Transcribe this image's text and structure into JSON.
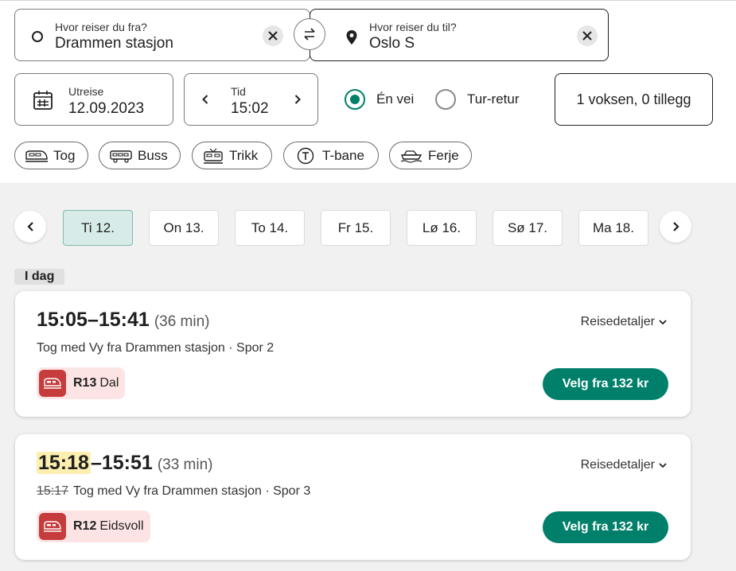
{
  "search": {
    "from": {
      "label": "Hvor reiser du fra?",
      "value": "Drammen stasjon"
    },
    "to": {
      "label": "Hvor reiser du til?",
      "value": "Oslo S"
    },
    "date": {
      "label": "Utreise",
      "value": "12.09.2023"
    },
    "time": {
      "label": "Tid",
      "value": "15:02"
    },
    "trip_type": {
      "one_way": "Én vei",
      "round_trip": "Tur-retur",
      "selected": "one_way"
    },
    "passengers": "1 voksen, 0 tillegg"
  },
  "transport_modes": [
    "Tog",
    "Buss",
    "Trikk",
    "T-bane",
    "Ferje"
  ],
  "dates": [
    "Ti 12.",
    "On 13.",
    "To 14.",
    "Fr 15.",
    "Lø 16.",
    "Sø 17.",
    "Ma 18."
  ],
  "day_label": "I dag",
  "trips": [
    {
      "dep": "15:05",
      "arr": "15:41",
      "sep": "–",
      "duration": "(36 min)",
      "details": "Reisedetaljer",
      "original_time": "",
      "description": "Tog med Vy fra Drammen stasjon · Spor 2",
      "line": "R13",
      "destination": "Dal",
      "button": "Velg fra 132 kr"
    },
    {
      "dep": "15:18",
      "arr": "15:51",
      "sep": "–",
      "duration": "(33 min)",
      "details": "Reisedetaljer",
      "original_time": "15:17",
      "description": "Tog med Vy fra Drammen stasjon · Spor 3",
      "line": "R12",
      "destination": "Eidsvoll",
      "button": "Velg fra 132 kr"
    }
  ],
  "colors": {
    "accent": "#00806a",
    "line_badge": "#c63b3b",
    "delay_highlight": "#fcefb0"
  }
}
